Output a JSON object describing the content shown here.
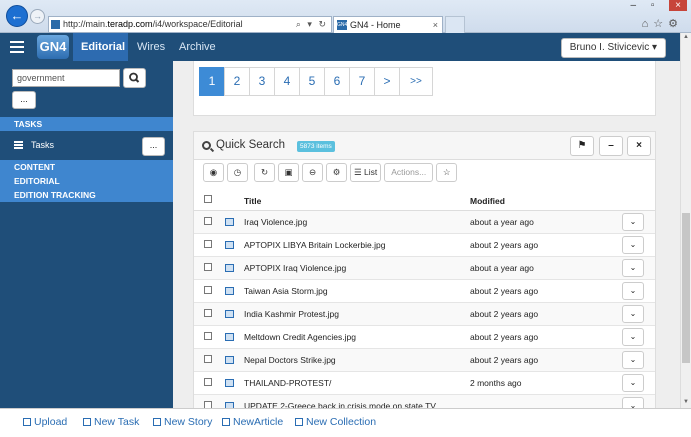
{
  "browser": {
    "url_prefix": "http://main.",
    "url_domain": "teradp.com",
    "url_path": "/i4/workspace/Editorial",
    "tab_title": "GN4 - Home",
    "favicon_text": "GN4"
  },
  "header": {
    "logo": "GN4",
    "nav": [
      "Editorial",
      "Wires",
      "Archive"
    ],
    "user": "Bruno I. Stivicevic ▾"
  },
  "sidebar": {
    "search_value": "government",
    "more_label": "...",
    "tasks_section": "TASKS",
    "tasks_item": "Tasks",
    "tasks_more": "...",
    "content_section": "CONTENT",
    "editorial_section": "EDITORIAL",
    "edition_section": "EDITION TRACKING"
  },
  "pagination": [
    "1",
    "2",
    "3",
    "4",
    "5",
    "6",
    "7",
    ">",
    ">>"
  ],
  "quick_search": {
    "title": "Quick Search",
    "count": "5873 items",
    "list_label": "List",
    "actions_label": "Actions...",
    "columns": {
      "title": "Title",
      "modified": "Modified"
    },
    "rows": [
      {
        "title": "Iraq Violence.jpg",
        "modified": "about a year ago"
      },
      {
        "title": "APTOPIX LIBYA Britain Lockerbie.jpg",
        "modified": "about 2 years ago"
      },
      {
        "title": "APTOPIX Iraq Violence.jpg",
        "modified": "about a year ago"
      },
      {
        "title": "Taiwan Asia Storm.jpg",
        "modified": "about 2 years ago"
      },
      {
        "title": "India Kashmir Protest.jpg",
        "modified": "about 2 years ago"
      },
      {
        "title": "Meltdown Credit Agencies.jpg",
        "modified": "about 2 years ago"
      },
      {
        "title": "Nepal Doctors Strike.jpg",
        "modified": "about 2 years ago"
      },
      {
        "title": "THAILAND-PROTEST/",
        "modified": "2 months ago"
      },
      {
        "title": "UPDATE 2-Greece back in crisis mode on state TV",
        "modified": ""
      }
    ]
  },
  "bottombar": [
    "Upload",
    "New Task",
    "New Story",
    "NewArticle",
    "New Collection"
  ],
  "colors": {
    "header": "#1f4e79",
    "accent": "#3f86cf",
    "active_page": "#3d8bd6",
    "count_badge": "#5bc0de"
  }
}
